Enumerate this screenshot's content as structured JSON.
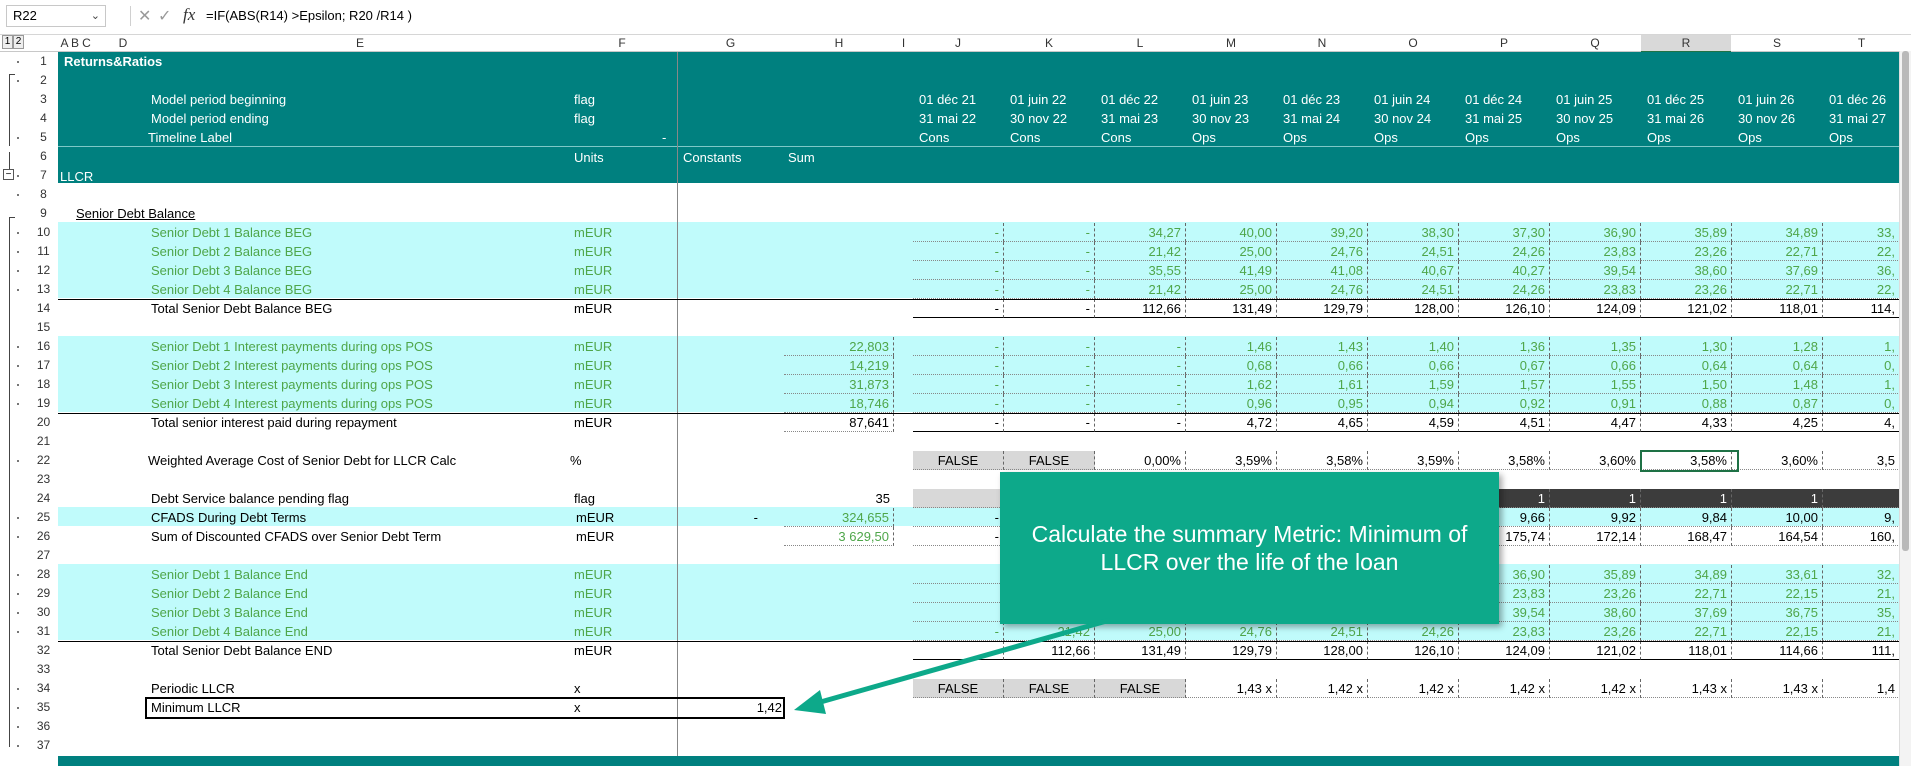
{
  "formula_bar": {
    "name_box": "R22",
    "formula": "=IF(ABS(R14) >Epsilon; R20 /R14 )"
  },
  "outline_levels": [
    "1",
    "2"
  ],
  "columns": [
    "A",
    "B",
    "C",
    "D",
    "E",
    "F",
    "G",
    "H",
    "I",
    "J",
    "K",
    "L",
    "M",
    "N",
    "O",
    "P",
    "Q",
    "R",
    "S",
    "T"
  ],
  "row_numbers": [
    "1",
    "2",
    "3",
    "4",
    "5",
    "6",
    "7",
    "8",
    "9",
    "10",
    "11",
    "12",
    "13",
    "14",
    "15",
    "16",
    "17",
    "18",
    "19",
    "20",
    "21",
    "22",
    "23",
    "24",
    "25",
    "26",
    "27",
    "28",
    "29",
    "30",
    "31",
    "32",
    "33",
    "34",
    "35",
    "36",
    "37"
  ],
  "header": {
    "title": "Returns&Ratios",
    "r3_label": "Model period beginning",
    "r4_label": "Model period ending",
    "r5_label": "Timeline Label",
    "r3_flag": "flag",
    "r4_flag": "flag",
    "r5_dash": "-",
    "units": "Units",
    "constants": "Constants",
    "sum": "Sum",
    "section": "LLCR",
    "period_begin": [
      "01 déc 21",
      "01 juin 22",
      "01 déc 22",
      "01 juin 23",
      "01 déc 23",
      "01 juin 24",
      "01 déc 24",
      "01 juin 25",
      "01 déc 25",
      "01 juin 26",
      "01 déc 26"
    ],
    "period_end": [
      "31 mai 22",
      "30 nov 22",
      "31 mai 23",
      "30 nov 23",
      "31 mai 24",
      "30 nov 24",
      "31 mai 25",
      "30 nov 25",
      "31 mai 26",
      "30 nov 26",
      "31 mai 27"
    ],
    "timeline": [
      "Cons",
      "Cons",
      "Cons",
      "Ops",
      "Ops",
      "Ops",
      "Ops",
      "Ops",
      "Ops",
      "Ops",
      "Ops"
    ]
  },
  "rows": {
    "r9": {
      "label": "Senior Debt Balance"
    },
    "r10": {
      "label": "Senior Debt 1 Balance BEG",
      "unit": "mEUR",
      "vals": [
        "-",
        "-",
        "34,27",
        "40,00",
        "39,20",
        "38,30",
        "37,30",
        "36,90",
        "35,89",
        "34,89",
        "33,"
      ]
    },
    "r11": {
      "label": "Senior Debt 2 Balance BEG",
      "unit": "mEUR",
      "vals": [
        "-",
        "-",
        "21,42",
        "25,00",
        "24,76",
        "24,51",
        "24,26",
        "23,83",
        "23,26",
        "22,71",
        "22,"
      ]
    },
    "r12": {
      "label": "Senior Debt 3 Balance BEG",
      "unit": "mEUR",
      "vals": [
        "-",
        "-",
        "35,55",
        "41,49",
        "41,08",
        "40,67",
        "40,27",
        "39,54",
        "38,60",
        "37,69",
        "36,"
      ]
    },
    "r13": {
      "label": "Senior Debt 4 Balance BEG",
      "unit": "mEUR",
      "vals": [
        "-",
        "-",
        "21,42",
        "25,00",
        "24,76",
        "24,51",
        "24,26",
        "23,83",
        "23,26",
        "22,71",
        "22,"
      ]
    },
    "r14": {
      "label": "Total Senior Debt Balance BEG",
      "unit": "mEUR",
      "vals": [
        "-",
        "-",
        "112,66",
        "131,49",
        "129,79",
        "128,00",
        "126,10",
        "124,09",
        "121,02",
        "118,01",
        "114,"
      ]
    },
    "r16": {
      "label": "Senior Debt 1 Interest payments during ops POS",
      "unit": "mEUR",
      "sum": "22,803",
      "vals": [
        "-",
        "-",
        "-",
        "1,46",
        "1,43",
        "1,40",
        "1,36",
        "1,35",
        "1,30",
        "1,28",
        "1,"
      ]
    },
    "r17": {
      "label": "Senior Debt 2 Interest payments during ops POS",
      "unit": "mEUR",
      "sum": "14,219",
      "vals": [
        "-",
        "-",
        "-",
        "0,68",
        "0,66",
        "0,66",
        "0,67",
        "0,66",
        "0,64",
        "0,64",
        "0,"
      ]
    },
    "r18": {
      "label": "Senior Debt 3 Interest payments during ops POS",
      "unit": "mEUR",
      "sum": "31,873",
      "vals": [
        "-",
        "-",
        "-",
        "1,62",
        "1,61",
        "1,59",
        "1,57",
        "1,55",
        "1,50",
        "1,48",
        "1,"
      ]
    },
    "r19": {
      "label": "Senior Debt 4 Interest payments during ops POS",
      "unit": "mEUR",
      "sum": "18,746",
      "vals": [
        "-",
        "-",
        "-",
        "0,96",
        "0,95",
        "0,94",
        "0,92",
        "0,91",
        "0,88",
        "0,87",
        "0,"
      ]
    },
    "r20": {
      "label": "Total senior interest paid during repayment",
      "unit": "mEUR",
      "sum": "87,641",
      "vals": [
        "-",
        "-",
        "-",
        "4,72",
        "4,65",
        "4,59",
        "4,51",
        "4,47",
        "4,33",
        "4,25",
        "4,"
      ]
    },
    "r22": {
      "label": "Weighted Average Cost of Senior Debt for LLCR Calc",
      "unit": "%",
      "vals": [
        "FALSE",
        "FALSE",
        "0,00%",
        "3,59%",
        "3,58%",
        "3,59%",
        "3,58%",
        "3,60%",
        "3,58%",
        "3,60%",
        "3,5"
      ]
    },
    "r24": {
      "label": "Debt Service balance pending flag",
      "unit": "flag",
      "sum": "35",
      "vals": [
        "",
        "",
        "",
        "",
        "",
        "",
        "1",
        "1",
        "1",
        "1",
        ""
      ]
    },
    "r25": {
      "label": "CFADS During Debt Terms",
      "unit": "mEUR",
      "const": "-",
      "sum": "324,655",
      "vals": [
        "-",
        "",
        "",
        "",
        "",
        "",
        "9,66",
        "9,92",
        "9,84",
        "10,00",
        "9,"
      ]
    },
    "r26": {
      "label": "Sum of Discounted CFADS over Senior Debt Term",
      "unit": "mEUR",
      "sum": "3 629,50",
      "vals": [
        "-",
        "",
        "",
        "",
        "",
        "",
        "175,74",
        "172,14",
        "168,47",
        "164,54",
        "160,"
      ]
    },
    "r28": {
      "label": "Senior Debt 1 Balance End",
      "unit": "mEUR",
      "vals": [
        "",
        "",
        "",
        "",
        "",
        "",
        "36,90",
        "35,89",
        "34,89",
        "33,61",
        "32,"
      ]
    },
    "r29": {
      "label": "Senior Debt 2 Balance End",
      "unit": "mEUR",
      "vals": [
        "",
        "",
        "",
        "",
        "",
        "",
        "23,83",
        "23,26",
        "22,71",
        "22,15",
        "21,"
      ]
    },
    "r30": {
      "label": "Senior Debt 3 Balance End",
      "unit": "mEUR",
      "vals": [
        "",
        "",
        "",
        "",
        "",
        "",
        "39,54",
        "38,60",
        "37,69",
        "36,75",
        "35,"
      ]
    },
    "r31": {
      "label": "Senior Debt 4 Balance End",
      "unit": "mEUR",
      "vals": [
        "-",
        "21,42",
        "25,00",
        "24,76",
        "24,51",
        "24,26",
        "23,83",
        "23,26",
        "22,71",
        "22,15",
        "21,"
      ]
    },
    "r32": {
      "label": "Total Senior Debt Balance END",
      "unit": "mEUR",
      "vals": [
        "-",
        "112,66",
        "131,49",
        "129,79",
        "128,00",
        "126,10",
        "124,09",
        "121,02",
        "118,01",
        "114,66",
        "111,"
      ]
    },
    "r34": {
      "label": "Periodic  LLCR",
      "unit": "x",
      "vals": [
        "FALSE",
        "FALSE",
        "FALSE",
        "1,43 x",
        "1,42 x",
        "1,42 x",
        "1,42 x",
        "1,42 x",
        "1,43 x",
        "1,43 x",
        "1,4"
      ]
    },
    "r35": {
      "label": "Minimum LLCR",
      "unit": "x",
      "const": "1,42"
    }
  },
  "callout": {
    "text": "Calculate the summary Metric: Minimum of LLCR over the life of the loan",
    "color": "#0da98a"
  },
  "colors": {
    "teal": "#00807f",
    "cyan": "#c0fbfb",
    "green_text": "#4fa64a",
    "selection": "#1e7145"
  }
}
